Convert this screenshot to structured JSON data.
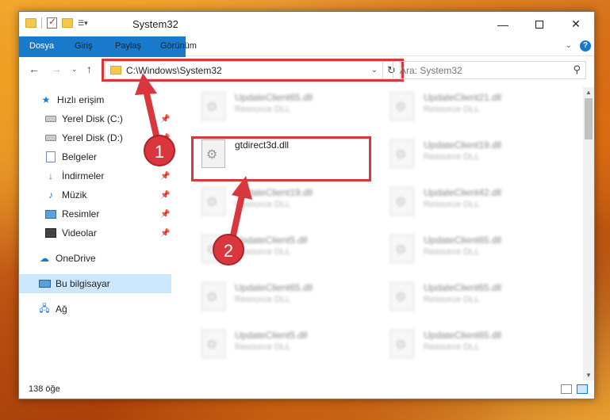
{
  "window": {
    "title": "System32"
  },
  "ribbon": {
    "tabs": [
      "Dosya",
      "Giriş",
      "Paylaş",
      "Görünüm"
    ],
    "help_label": "?"
  },
  "address": {
    "path": "C:\\Windows\\System32",
    "search_placeholder": "Ara: System32"
  },
  "sidebar": {
    "items": [
      {
        "label": "Hızlı erişim",
        "icon": "star-icon",
        "pinned": false
      },
      {
        "label": "Yerel Disk (C:)",
        "icon": "disk-icon",
        "pinned": true
      },
      {
        "label": "Yerel Disk (D:)",
        "icon": "disk-icon",
        "pinned": true
      },
      {
        "label": "Belgeler",
        "icon": "documents-icon",
        "pinned": true
      },
      {
        "label": "İndirmeler",
        "icon": "downloads-icon",
        "pinned": true
      },
      {
        "label": "Müzik",
        "icon": "music-icon",
        "pinned": true
      },
      {
        "label": "Resimler",
        "icon": "pictures-icon",
        "pinned": true
      },
      {
        "label": "Videolar",
        "icon": "videos-icon",
        "pinned": true
      },
      {
        "label": "OneDrive",
        "icon": "cloud-icon",
        "pinned": false
      },
      {
        "label": "Bu bilgisayar",
        "icon": "computer-icon",
        "pinned": false,
        "selected": true
      },
      {
        "label": "Ağ",
        "icon": "network-icon",
        "pinned": false
      }
    ]
  },
  "files": [
    {
      "name": "UpdateClient65.dll",
      "type": "Resource DLL",
      "blurred": true
    },
    {
      "name": "UpdateClient21.dll",
      "type": "Resource DLL",
      "blurred": true
    },
    {
      "name": "gtdirect3d.dll",
      "type": "",
      "blurred": false
    },
    {
      "name": "UpdateClient19.dll",
      "type": "Resource DLL",
      "blurred": true
    },
    {
      "name": "UpdateClient19.dll",
      "type": "Resource DLL",
      "blurred": true
    },
    {
      "name": "UpdateClient42.dll",
      "type": "Resource DLL",
      "blurred": true
    },
    {
      "name": "UpdateClient5.dll",
      "type": "Resource DLL",
      "blurred": true
    },
    {
      "name": "UpdateClient65.dll",
      "type": "Resource DLL",
      "blurred": true
    },
    {
      "name": "UpdateClient65.dll",
      "type": "Resource DLL",
      "blurred": true
    },
    {
      "name": "UpdateClient65.dll",
      "type": "Resource DLL",
      "blurred": true
    },
    {
      "name": "UpdateClient5.dll",
      "type": "Resource DLL",
      "blurred": true
    },
    {
      "name": "UpdateClient65.dll",
      "type": "Resource DLL",
      "blurred": true
    }
  ],
  "status": {
    "item_count": "138 öğe"
  },
  "callouts": [
    "1",
    "2"
  ],
  "colors": {
    "accent": "#1979ca",
    "highlight": "#d8373d",
    "selected_bg": "#cce8ff"
  }
}
